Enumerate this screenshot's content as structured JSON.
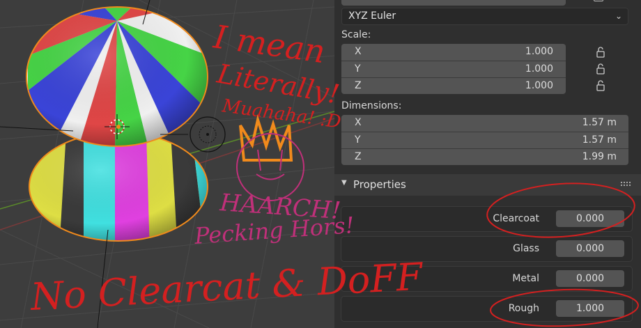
{
  "rotation_mode": {
    "value": "XYZ Euler"
  },
  "scale": {
    "label": "Scale:",
    "fields": [
      {
        "axis": "X",
        "value": "1.000"
      },
      {
        "axis": "Y",
        "value": "1.000"
      },
      {
        "axis": "Z",
        "value": "1.000"
      }
    ]
  },
  "dimensions": {
    "label": "Dimensions:",
    "fields": [
      {
        "axis": "X",
        "value": "1.57 m"
      },
      {
        "axis": "Y",
        "value": "1.57 m"
      },
      {
        "axis": "Z",
        "value": "1.99 m"
      }
    ]
  },
  "properties": {
    "title": "Properties",
    "rows": [
      {
        "label": "Clearcoat",
        "value": "0.000"
      },
      {
        "label": "Glass",
        "value": "0.000"
      },
      {
        "label": "Metal",
        "value": "0.000"
      },
      {
        "label": "Rough",
        "value": "1.000"
      }
    ]
  },
  "annotations": {
    "line1": "I mean",
    "line2": "Literally!",
    "line3": "Muahaha! :D",
    "line4": "HAARCH!",
    "line5": "Pecking Hors!",
    "line6": "No Clearcat & DoFF"
  },
  "colors": {
    "accent_orange": "#f08a1c",
    "ink_red": "#d42020",
    "ink_magenta": "#c0307a"
  }
}
